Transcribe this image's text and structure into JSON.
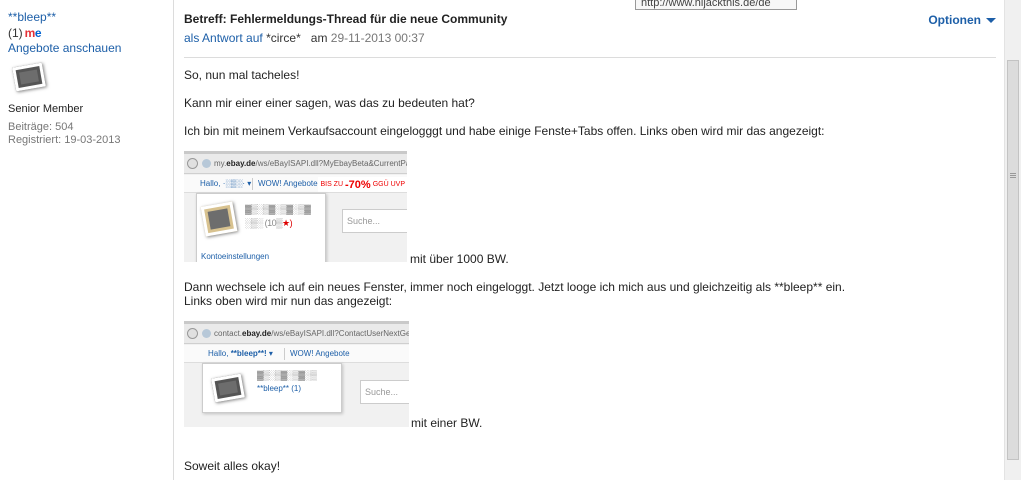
{
  "author": {
    "name": "**bleep**",
    "feedback_count": "(1)",
    "badge_m": "m",
    "badge_e": "e",
    "offers_link": "Angebote anschauen",
    "role": "Senior Member",
    "posts": "Beiträge: 504",
    "registered": "Registriert: 19-03-2013"
  },
  "post": {
    "subject": "Betreff: Fehlermeldungs-Thread für die neue Community",
    "reply_prefix": "als Antwort auf",
    "reply_to": "*circe*",
    "date_prefix": "am",
    "date": "29-11-2013 00:37",
    "options_label": "Optionen",
    "paragraphs": {
      "p1": "So, nun mal tacheles!",
      "p2": "Kann mir einer einer sagen, was das zu bedeuten hat?",
      "p3": "Ich bin mit meinem Verkaufsaccount eingelogggt und habe einige Fenste+Tabs offen. Links oben wird mir das angezeigt:",
      "p4": "mit über 1000 BW.",
      "p5a": "Dann wechsele ich auf ein neues Fenster, immer noch eingeloggt. Jetzt looge ich mich aus und gleichzeitig als **bleep** ein.",
      "p5b": "Links oben wird mir nun das angezeigt:",
      "p6": "mit einer BW.",
      "p7": "Soweit alles okay!"
    }
  },
  "screenshot1": {
    "url_prefix": "my.",
    "url_domain": "ebay.de",
    "url_rest": "/ws/eBayISAPI.dll?MyEbayBeta&CurrentPage=",
    "greeting": "Hallo,",
    "greeting_name": "·░▒░·",
    "wow": "WOW! Angebote",
    "promo_left": "BIS ZU",
    "promo_big": "-70%",
    "promo_right": "GGÜ UVP",
    "blurred_name": "▓▒░▒▓░▒▓░▒▓",
    "blurred_rating": "░▒░ (10▒",
    "star": "★)",
    "search": "Suche...",
    "account_settings": "Kontoeinstellungen"
  },
  "screenshot2": {
    "url_prefix": "contact.",
    "url_domain": "ebay.de",
    "url_rest": "/ws/eBayISAPI.dll?ContactUserNextGen",
    "greeting": "Hallo,",
    "greeting_name": "**bleep**!",
    "wow": "WOW! Angebote",
    "blurred_name": "▓▒░▒▓░▒▓░▒",
    "username": "**bleep** (1)",
    "search": "Suche..."
  },
  "tooltip": "http://www.hijackthis.de/de"
}
